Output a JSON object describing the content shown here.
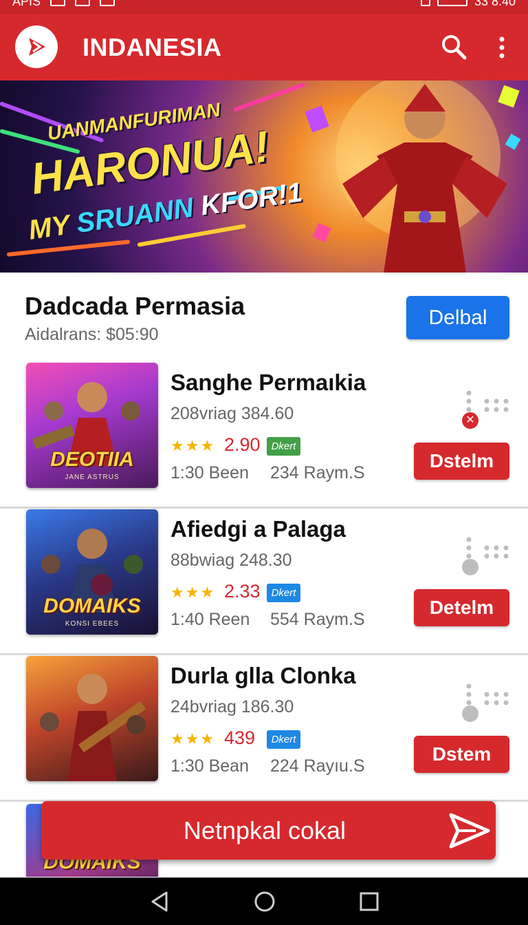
{
  "status_bar": {
    "left_text": "APIS",
    "right_text": "33 8:40"
  },
  "app_bar": {
    "title": "INDANESIA",
    "logo_icon": "play-logo-icon",
    "search_icon": "search-icon",
    "menu_icon": "more-vert-icon"
  },
  "banner": {
    "line1": "UANMANFURIMAN",
    "line2": "HARONUA!",
    "line3_a": "MY ",
    "line3_b": "SRUANN ",
    "line3_c": "KFOR!1"
  },
  "section": {
    "title": "Dadcada Permasia",
    "subtitle": "Aidalrans: $05:90",
    "button_label": "Delbal"
  },
  "items": [
    {
      "name": "Sanghе Permaıkia",
      "meta1": "208vriag 384.60",
      "stars": "★★★",
      "rating": "2.90",
      "tag": "Dkert",
      "tag_color": "#43a047",
      "meta2": "1:30 Been",
      "meta3": "234 Raym.S",
      "button_label": "Dstelm",
      "thumb_caption": "DEOTIIA",
      "thumb_sub": "JANE ASTRUS",
      "status": "error"
    },
    {
      "name": "Afiedgi a Palaga",
      "meta1": "88bwiag 248.30",
      "stars": "★★★",
      "rating": "2.33",
      "tag": "Dkert",
      "tag_color": "#1e88e5",
      "meta2": "1:40 Reen",
      "meta3": "554 Raym.S",
      "button_label": "Detelm",
      "thumb_caption": "DOMAIKS",
      "thumb_sub": "KONSI EBEES",
      "status": "idle"
    },
    {
      "name": "Durla glla Clonka",
      "meta1": "24bvriag 186.30",
      "stars": "★★★",
      "rating": "439",
      "tag": "Dkert",
      "tag_color": "#1e88e5",
      "meta2": "1:30 Bean",
      "meta3": "224 Rayıu.S",
      "button_label": "Dstem",
      "thumb_caption": "",
      "thumb_sub": "",
      "status": "idle"
    }
  ],
  "partial_item": {
    "thumb_caption": "DOMAIKS"
  },
  "floating_bar": {
    "label": "Netnpkal cokal",
    "icon": "send-icon"
  },
  "nav_bar": {
    "back_icon": "back-triangle-icon",
    "home_icon": "home-circle-icon",
    "recents_icon": "recents-square-icon"
  },
  "colors": {
    "primary_red": "#d6292e",
    "primary_blue": "#1a73e8",
    "star": "#f5b400"
  }
}
